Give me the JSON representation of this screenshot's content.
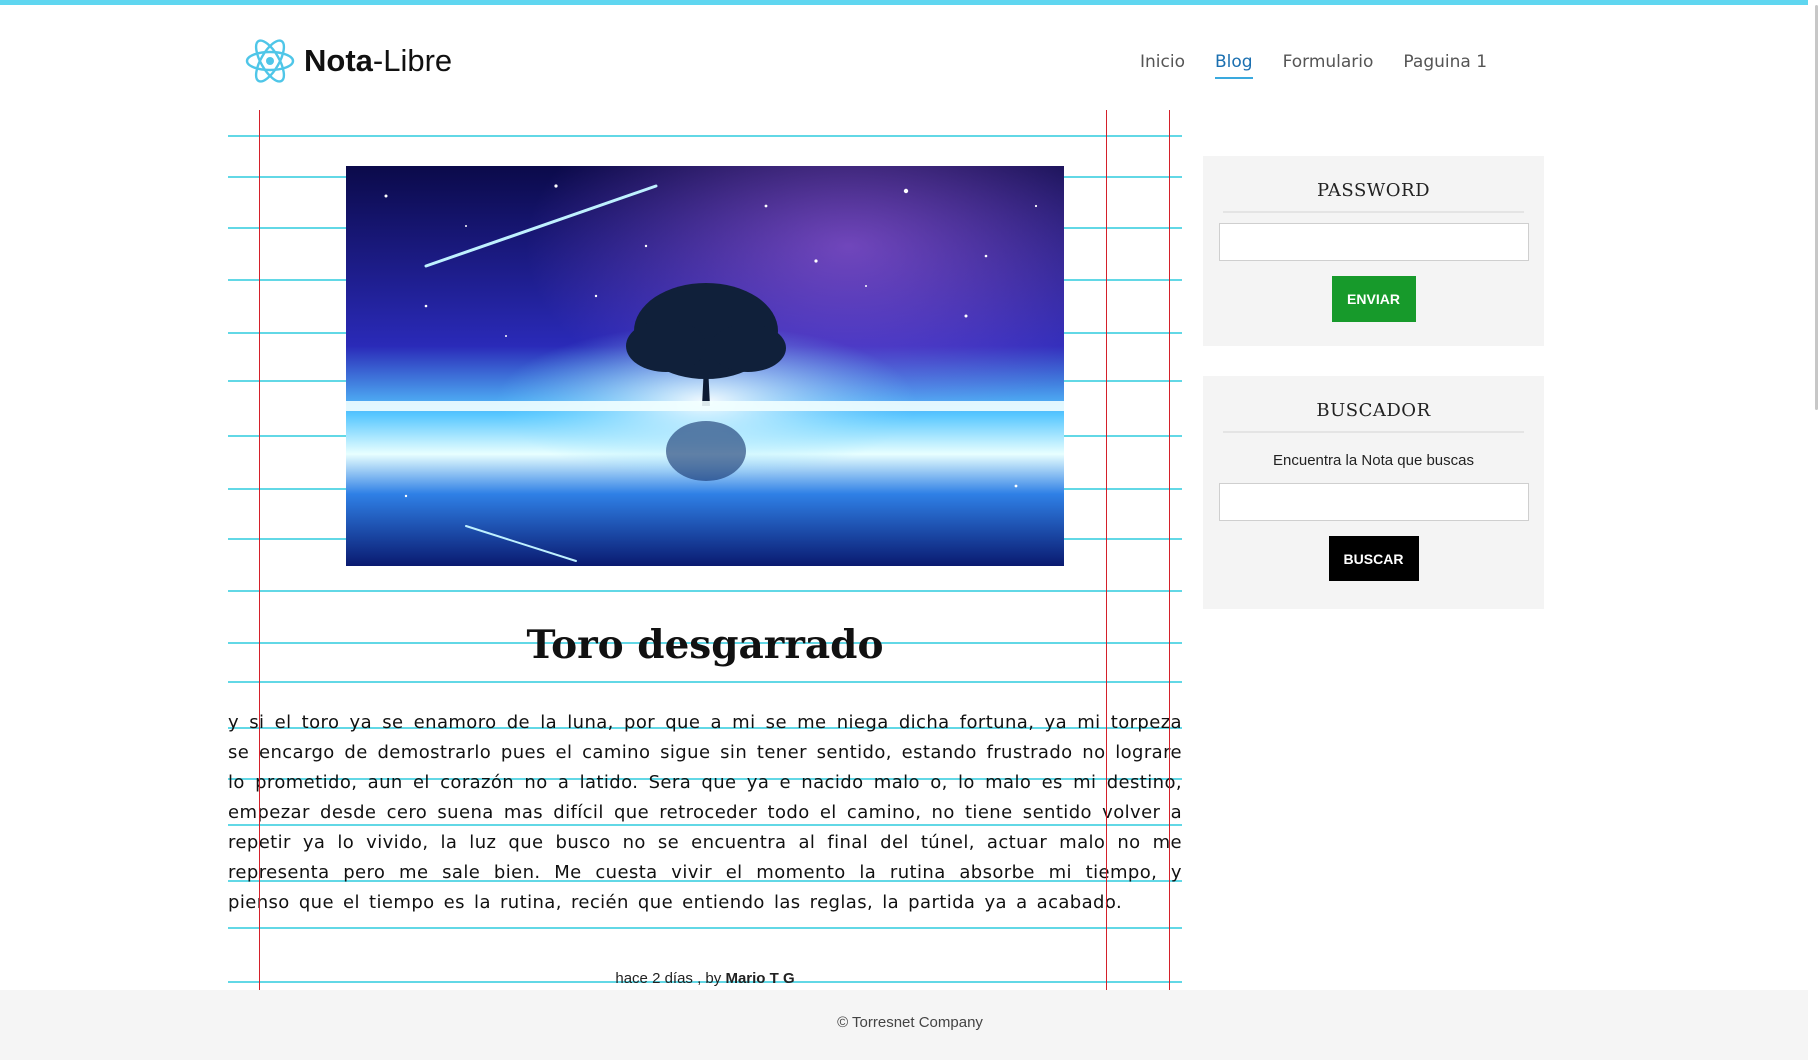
{
  "brand": {
    "name_bold": "Nota",
    "name_rest": "-Libre",
    "logo_icon": "atom-icon",
    "accent": "#5fd6f0"
  },
  "nav": {
    "items": [
      {
        "label": "Inicio",
        "active": false
      },
      {
        "label": "Blog",
        "active": true
      },
      {
        "label": "Formulario",
        "active": false
      },
      {
        "label": "Paguina 1",
        "active": false
      }
    ]
  },
  "post": {
    "image_alt": "galaxy-tree-image",
    "title": "Toro desgarrado",
    "body": "y si el toro ya se enamoro de la luna, por que a mi se me niega dicha fortuna, ya mi torpeza se encargo de demostrarlo pues el camino sigue sin tener sentido, estando frustrado no lograre lo prometido, aun el corazón no a latido. Sera que ya e nacido malo o, lo malo es mi destino, empezar desde cero suena mas difícil que retroceder todo el camino, no tiene sentido volver a repetir ya lo vivido, la luz que busco no se encuentra al final del túnel, actuar malo no me representa pero me sale bien. Me cuesta vivir el momento la rutina absorbe mi tiempo, y pienso que el tiempo es la rutina, recién que entiendo las reglas, la partida ya a acabado.",
    "meta_prefix": "hace 2 días , by ",
    "author": "Mario T G"
  },
  "sidebar": {
    "password": {
      "title": "PASSWORD",
      "input_value": "",
      "button_label": "ENVIAR",
      "button_color": "#179a2b"
    },
    "search": {
      "title": "BUSCADOR",
      "description": "Encuentra la Nota que buscas",
      "input_value": "",
      "button_label": "BUSCAR",
      "button_color": "#000000"
    }
  },
  "footer": {
    "text": "© Torresnet Company"
  },
  "colors": {
    "ruled_line": "#62d8e6",
    "margin_line": "#d4202a",
    "widget_bg": "#f4f4f4"
  }
}
